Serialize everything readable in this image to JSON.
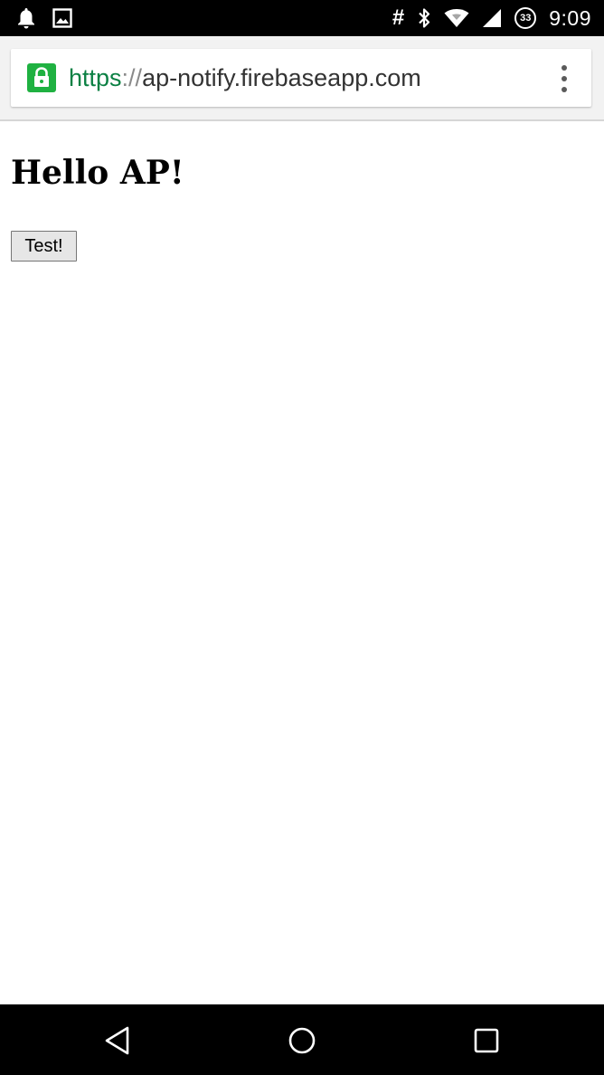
{
  "status_bar": {
    "time": "9:09",
    "battery_level": "33",
    "icons": [
      "notification-bell-icon",
      "image-icon",
      "hash-icon",
      "bluetooth-icon",
      "wifi-icon",
      "cell-signal-icon",
      "battery-icon"
    ],
    "hash_symbol": "#"
  },
  "browser": {
    "url_scheme": "https",
    "url_separator": "://",
    "url_host": "ap-notify.firebaseapp.com",
    "secure_color": "#1fb141",
    "toolbar_bg": "#f2f2f2",
    "menu_icon": "overflow-menu-icon"
  },
  "page": {
    "heading": "Hello AP!",
    "test_button_label": "Test!"
  },
  "nav_bar": {
    "icons": [
      "back-icon",
      "home-icon",
      "recents-icon"
    ]
  }
}
